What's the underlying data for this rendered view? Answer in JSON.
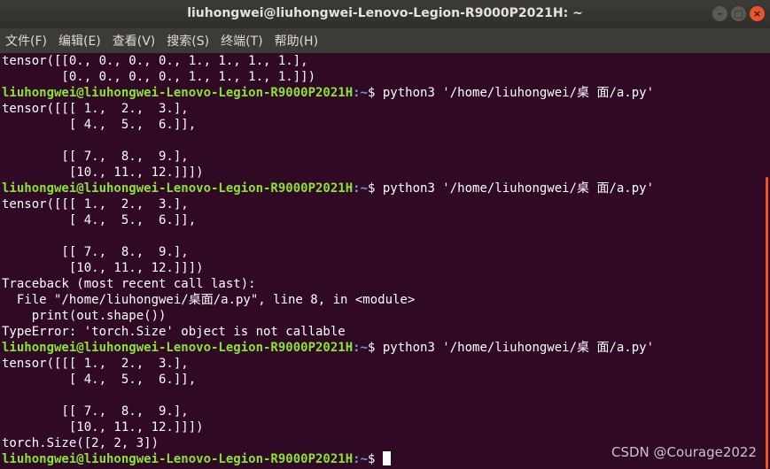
{
  "window": {
    "title": "liuhongwei@liuhongwei-Lenovo-Legion-R9000P2021H: ~",
    "buttons": {
      "minimize": "–",
      "maximize": "□",
      "close": "×"
    }
  },
  "menu": [
    "文件(F)",
    "编辑(E)",
    "查看(V)",
    "搜索(S)",
    "终端(T)",
    "帮助(H)"
  ],
  "prompt": {
    "user_host": "liuhongwei@liuhongwei-Lenovo-Legion-R9000P2021H",
    "path": ":~",
    "symbol": "$ "
  },
  "terminal_lines": [
    {
      "type": "out",
      "text": "tensor([[0., 0., 0., 0., 1., 1., 1., 1.],"
    },
    {
      "type": "out",
      "text": "        [0., 0., 0., 0., 1., 1., 1., 1.]])"
    },
    {
      "type": "prompt",
      "cmd": "python3 '/home/liuhongwei/桌 面/a.py'"
    },
    {
      "type": "out",
      "text": "tensor([[[ 1.,  2.,  3.],"
    },
    {
      "type": "out",
      "text": "         [ 4.,  5.,  6.]],"
    },
    {
      "type": "out",
      "text": ""
    },
    {
      "type": "out",
      "text": "        [[ 7.,  8.,  9.],"
    },
    {
      "type": "out",
      "text": "         [10., 11., 12.]]])"
    },
    {
      "type": "prompt",
      "cmd": "python3 '/home/liuhongwei/桌 面/a.py'"
    },
    {
      "type": "out",
      "text": "tensor([[[ 1.,  2.,  3.],"
    },
    {
      "type": "out",
      "text": "         [ 4.,  5.,  6.]],"
    },
    {
      "type": "out",
      "text": ""
    },
    {
      "type": "out",
      "text": "        [[ 7.,  8.,  9.],"
    },
    {
      "type": "out",
      "text": "         [10., 11., 12.]]])"
    },
    {
      "type": "out",
      "text": "Traceback (most recent call last):"
    },
    {
      "type": "out",
      "text": "  File \"/home/liuhongwei/桌面/a.py\", line 8, in <module>"
    },
    {
      "type": "out",
      "text": "    print(out.shape())"
    },
    {
      "type": "out",
      "text": "TypeError: 'torch.Size' object is not callable"
    },
    {
      "type": "prompt",
      "cmd": "python3 '/home/liuhongwei/桌 面/a.py'"
    },
    {
      "type": "out",
      "text": "tensor([[[ 1.,  2.,  3.],"
    },
    {
      "type": "out",
      "text": "         [ 4.,  5.,  6.]],"
    },
    {
      "type": "out",
      "text": ""
    },
    {
      "type": "out",
      "text": "        [[ 7.,  8.,  9.],"
    },
    {
      "type": "out",
      "text": "         [10., 11., 12.]]])"
    },
    {
      "type": "out",
      "text": "torch.Size([2, 2, 3])"
    },
    {
      "type": "prompt",
      "cmd": "",
      "cursor": true
    }
  ],
  "watermark": "CSDN @Courage2022",
  "colors": {
    "background": "#300a24",
    "prompt_user": "#8ae234",
    "prompt_path": "#729fcf",
    "close_button": "#e9542a"
  }
}
